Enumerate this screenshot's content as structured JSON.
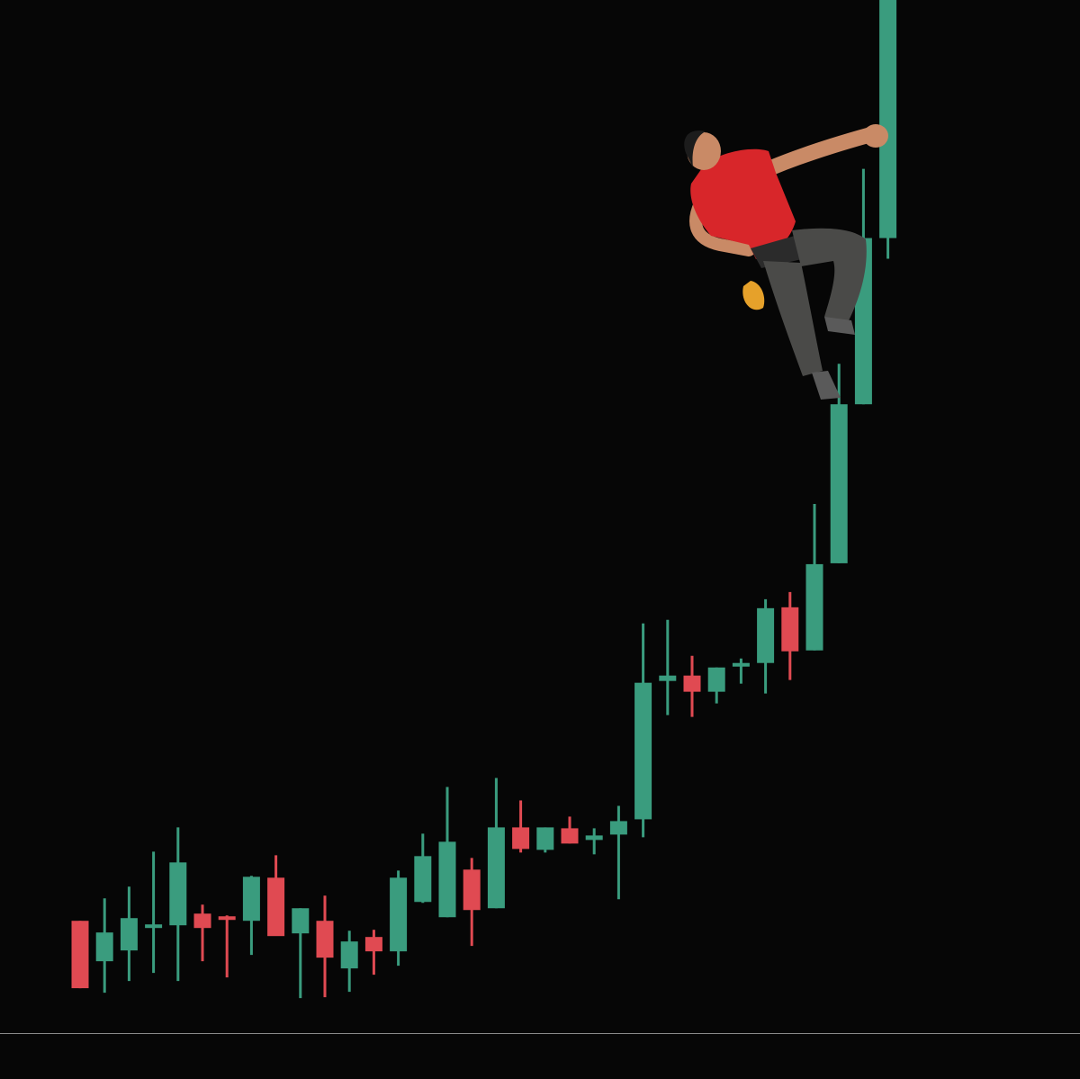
{
  "chart_data": {
    "type": "candlestick",
    "title": "",
    "xlabel": "",
    "ylabel": "",
    "grid": false,
    "legend": "none",
    "ylim": [
      0,
      1150
    ],
    "colors": {
      "up": "#3a9c7e",
      "down": "#e04a52",
      "background": "#060606",
      "axis": "#8a8a8a"
    },
    "candles": [
      {
        "open": 125,
        "high": 125,
        "low": 50,
        "close": 50
      },
      {
        "open": 80,
        "high": 150,
        "low": 45,
        "close": 112
      },
      {
        "open": 92,
        "high": 163,
        "low": 58,
        "close": 128
      },
      {
        "open": 119,
        "high": 202,
        "low": 67,
        "close": 121
      },
      {
        "open": 120,
        "high": 229,
        "low": 58,
        "close": 190
      },
      {
        "open": 133,
        "high": 143,
        "low": 80,
        "close": 117
      },
      {
        "open": 130,
        "high": 131,
        "low": 62,
        "close": 126
      },
      {
        "open": 125,
        "high": 175,
        "low": 87,
        "close": 174
      },
      {
        "open": 173,
        "high": 198,
        "low": 110,
        "close": 108
      },
      {
        "open": 111,
        "high": 139,
        "low": 39,
        "close": 139
      },
      {
        "open": 125,
        "high": 153,
        "low": 40,
        "close": 84
      },
      {
        "open": 72,
        "high": 114,
        "low": 46,
        "close": 102
      },
      {
        "open": 107,
        "high": 115,
        "low": 65,
        "close": 91
      },
      {
        "open": 91,
        "high": 181,
        "low": 75,
        "close": 173
      },
      {
        "open": 146,
        "high": 222,
        "low": 145,
        "close": 197
      },
      {
        "open": 129,
        "high": 274,
        "low": 129,
        "close": 213
      },
      {
        "open": 182,
        "high": 195,
        "low": 97,
        "close": 137
      },
      {
        "open": 139,
        "high": 284,
        "low": 139,
        "close": 229
      },
      {
        "open": 229,
        "high": 259,
        "low": 201,
        "close": 205
      },
      {
        "open": 204,
        "high": 229,
        "low": 201,
        "close": 229
      },
      {
        "open": 228,
        "high": 241,
        "low": 211,
        "close": 211
      },
      {
        "open": 215,
        "high": 228,
        "low": 199,
        "close": 220
      },
      {
        "open": 221,
        "high": 253,
        "low": 149,
        "close": 236
      },
      {
        "open": 238,
        "high": 456,
        "low": 218,
        "close": 390
      },
      {
        "open": 392,
        "high": 460,
        "low": 354,
        "close": 398
      },
      {
        "open": 398,
        "high": 420,
        "low": 352,
        "close": 380
      },
      {
        "open": 380,
        "high": 407,
        "low": 367,
        "close": 407
      },
      {
        "open": 410,
        "high": 417,
        "low": 389,
        "close": 412
      },
      {
        "open": 412,
        "high": 483,
        "low": 378,
        "close": 473
      },
      {
        "open": 474,
        "high": 491,
        "low": 393,
        "close": 425
      },
      {
        "open": 426,
        "high": 589,
        "low": 426,
        "close": 522
      },
      {
        "open": 523,
        "high": 745,
        "low": 523,
        "close": 700
      },
      {
        "open": 700,
        "high": 962,
        "low": 700,
        "close": 885
      },
      {
        "open": 885,
        "high": 1150,
        "low": 862,
        "close": 1150
      }
    ]
  },
  "illustration": {
    "subject": "rock-climber",
    "shirt_color": "#d8262a",
    "pants_color": "#4a4a48",
    "skin_color": "#c98a66"
  }
}
